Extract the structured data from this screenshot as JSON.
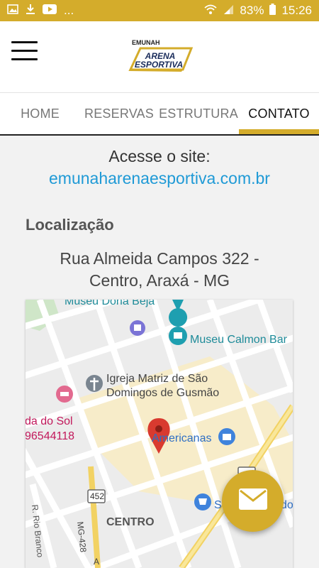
{
  "status_bar": {
    "ellipsis": "...",
    "battery": "83%",
    "time": "15:26"
  },
  "header": {
    "logo_top": "EMUNAH",
    "logo_line1": "ARENA",
    "logo_line2": "ESPORTIVA"
  },
  "tabs": [
    {
      "label": "HOME"
    },
    {
      "label": "RESERVAS"
    },
    {
      "label": "ESTRUTURA"
    },
    {
      "label": "CONTATO"
    }
  ],
  "contact": {
    "site_label": "Acesse o site:",
    "site_url": "emunaharenaesportiva.com.br",
    "location_title": "Localização",
    "address_line1": "Rua Almeida Campos 322 -",
    "address_line2": "Centro, Araxá - MG"
  },
  "map": {
    "labels": {
      "museu_dona_beja": "Museu Dona Beja",
      "museu_calmon": "Museu Calmon Bar",
      "igreja_line1": "Igreja Matriz de São",
      "igreja_line2": "Domingos de Gusmão",
      "hotel_partial": "da do Sol",
      "phone_partial": "96544118",
      "americanas": "Americanas",
      "supermarket_s": "S",
      "supermarket_do": "do",
      "centro": "CENTRO",
      "road_452": "452",
      "road_mg428": "MG-428",
      "rio_branco": "R. Rio Branco",
      "road_a": "A"
    }
  },
  "colors": {
    "accent": "#d4ac2b",
    "link": "#1f9ad6"
  },
  "icons": {
    "fab": "envelope-icon",
    "menu": "hamburger-icon"
  }
}
